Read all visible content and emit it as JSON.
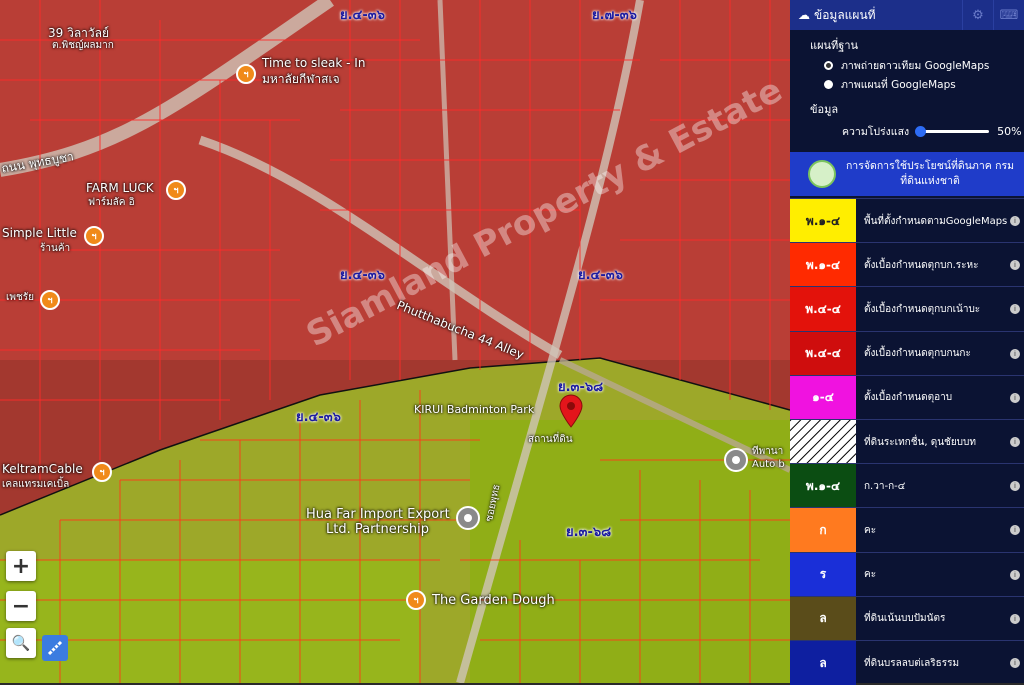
{
  "map": {
    "zones": [
      {
        "text": "ย.๔-๓๖"
      },
      {
        "text": "ย.๗-๓๖"
      },
      {
        "text": "ย.๔-๓๖"
      },
      {
        "text": "ย.๔-๓๖"
      },
      {
        "text": "ย.๔-๓๖"
      },
      {
        "text": "ย.๓-๖๘"
      },
      {
        "text": "ย.๓-๖๘"
      }
    ],
    "places": {
      "p1": "39 วิลาวัลย์",
      "p1b": "ต.พิชญ์ผลมาก",
      "p2": "Time to sleak - In",
      "p2b": "มหาลัยกีฬาสเจ",
      "p3": "ถนน พุทธบูชา",
      "p4": "FARM LUCK",
      "p4b": "ฟาร์มลัค อิ",
      "p5": "Simple Little",
      "p5b": "ร้านค้า",
      "p6": "เพชรัย",
      "p7": "Phutthabucha 44 Alley",
      "p8": "KIRUI Badminton Park",
      "p9": "สถานที่ดิน",
      "p10": "KeltramCable",
      "p10b": "เคลแทรมเคเบิ้ล",
      "p11": "Hua Far Import Export",
      "p11b": "Ltd. Partnership",
      "p12": "The Garden Dough",
      "p13": "ทีพานา",
      "p13b": "Auto b",
      "p14": "ซอยพุทธ"
    },
    "poi_glyph": "ฯ",
    "watermark": "Siamland Property & Estate",
    "controls": {
      "zoom_in": "+",
      "zoom_out": "−",
      "search": "🔍"
    }
  },
  "panel": {
    "header_title": "ข้อมูลแผนที่",
    "section_base": "แผนที่ฐาน",
    "base_options": [
      {
        "label": "ภาพถ่ายดาวเทียม GoogleMaps",
        "selected": true
      },
      {
        "label": "ภาพแผนที่ GoogleMaps",
        "selected": false
      }
    ],
    "section_data": "ข้อมูล",
    "opacity_label": "ความโปร่งแสง",
    "opacity_value": "50%",
    "opacity_fraction": 0.5,
    "banner": "การจัดการใช้ประโยชน์ที่ดินภาค กรมที่ดินแห่งชาติ",
    "legend": [
      {
        "code": "พ.๑-๔",
        "label": "พื้นที่ตั้งกำหนดตามGoogleMaps",
        "bg": "#ffee00",
        "fg": "#222222"
      },
      {
        "code": "พ.๑-๔",
        "label": "ตั้งเบื้องกำหนดตุกบก.ระหะ",
        "bg": "#ff2a00",
        "fg": "#ffffff"
      },
      {
        "code": "พ.๔-๔",
        "label": "ตั้งเบื้องกำหนดตุกบกเน้าบะ",
        "bg": "#e3120b",
        "fg": "#ffffff"
      },
      {
        "code": "พ.๔-๔",
        "label": "ตั้งเบื้องกำหนดตุกบกนกะ",
        "bg": "#cf0d0d",
        "fg": "#ffffff"
      },
      {
        "code": "๑-๔",
        "label": "ตั้งเบื้องกำหนดตุอาบ",
        "bg": "#f012e0",
        "fg": "#ffffff"
      },
      {
        "code": "",
        "label": "ที่ดินระเทกชื่น, ดุนชัยบบท",
        "bg": "#ffffff",
        "fg": "#000000"
      },
      {
        "code": "พ.๑-๔",
        "label": "ก.วา-ก-๔",
        "bg": "#0b4d12",
        "fg": "#ffffff"
      },
      {
        "code": "ก",
        "label": "คะ",
        "bg": "#ff7a1f",
        "fg": "#ffffff"
      },
      {
        "code": "ร",
        "label": "คะ",
        "bg": "#1a2fd8",
        "fg": "#ffffff"
      },
      {
        "code": "ล",
        "label": "ที่ดินเน้นบบปัมนัตร",
        "bg": "#5a4c1a",
        "fg": "#ffffff"
      },
      {
        "code": "ล",
        "label": "ที่ดินบรลลบต่เลริธรรม",
        "bg": "#0e1fa0",
        "fg": "#ffffff"
      }
    ],
    "colors": {
      "header": "#1c2f8a",
      "bg": "#0b1333",
      "banner": "#1f3cc9",
      "accent": "#2d6cf5"
    }
  }
}
